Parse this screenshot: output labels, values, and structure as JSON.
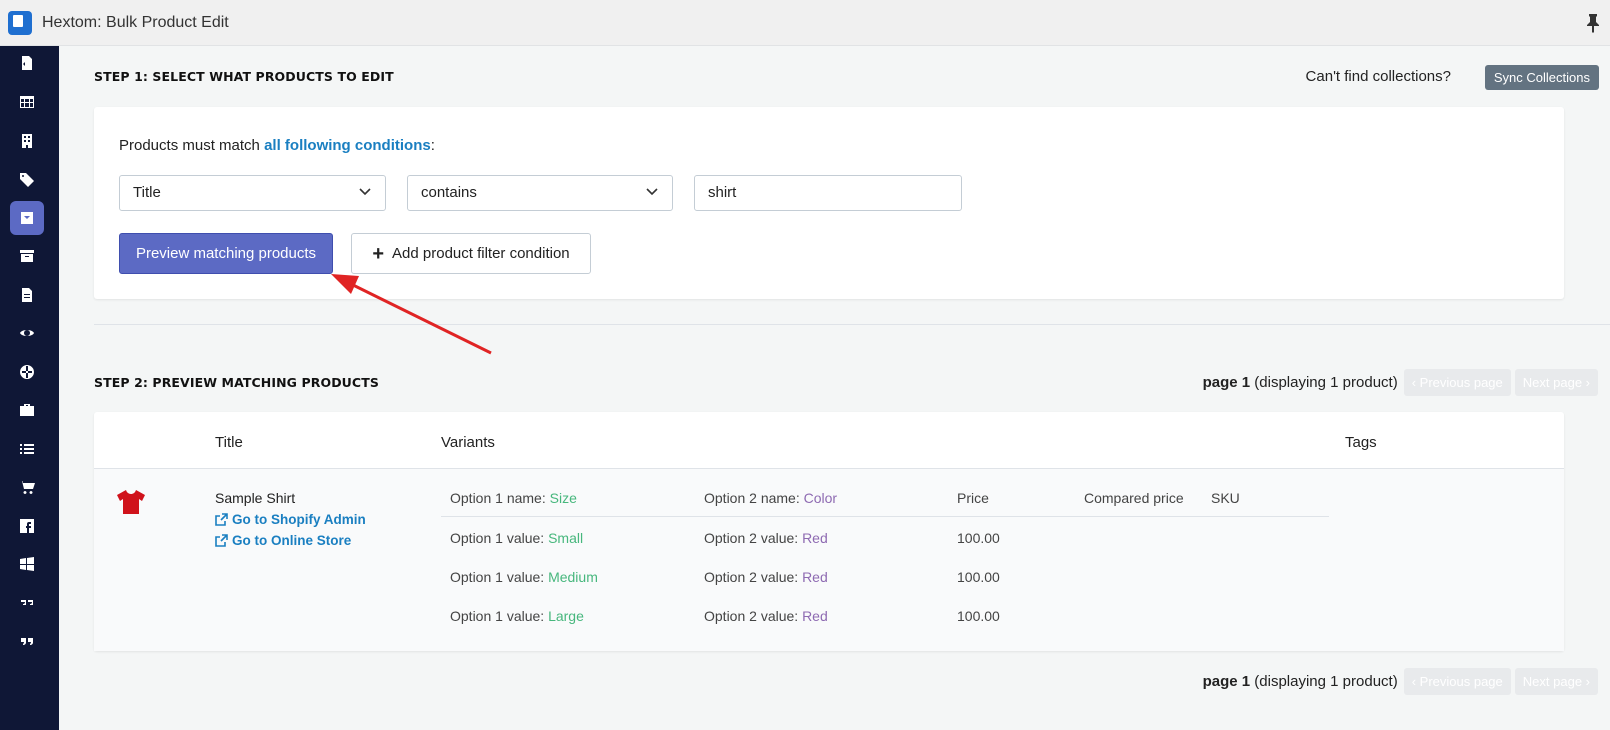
{
  "app": {
    "title": "Hextom: Bulk Product Edit"
  },
  "sidebar": {
    "icons": [
      "file-code-icon",
      "table-icon",
      "building-icon",
      "tag-icon",
      "archive-box-icon",
      "inbox-icon",
      "document-icon",
      "eye-icon",
      "globe-icon",
      "briefcase-icon",
      "list-icon",
      "cart-icon",
      "facebook-icon",
      "windows-icon",
      "quote-left-icon",
      "quote-right-icon"
    ],
    "active_index": 4
  },
  "step1": {
    "title": "STEP 1: SELECT WHAT PRODUCTS TO EDIT",
    "cant_find": "Can't find collections?",
    "sync_label": "Sync Collections",
    "conditions_prefix": "Products must match ",
    "conditions_link": "all following conditions",
    "conditions_suffix": ":",
    "field_value": "Title",
    "operator_value": "contains",
    "filter_value": "shirt",
    "preview_label": "Preview matching products",
    "add_filter_label": "Add product filter condition"
  },
  "step2": {
    "title": "STEP 2: PREVIEW MATCHING PRODUCTS",
    "pager": {
      "page_label": "page 1",
      "count_label": " (displaying 1 product)",
      "prev_label": "Previous page",
      "next_label": "Next page"
    },
    "columns": {
      "title": "Title",
      "variants": "Variants",
      "tags": "Tags"
    },
    "product": {
      "title": "Sample Shirt",
      "admin_link": "Go to Shopify Admin",
      "store_link": "Go to Online Store",
      "image_color": "#d0121b"
    },
    "variant_header": {
      "opt1_label": "Option 1 name: ",
      "opt1_name": "Size",
      "opt2_label": "Option 2 name: ",
      "opt2_name": "Color",
      "price": "Price",
      "compared": "Compared price",
      "sku": "SKU"
    },
    "variants": [
      {
        "opt1_label": "Option 1 value: ",
        "opt1": "Small",
        "opt2_label": "Option 2 value: ",
        "opt2": "Red",
        "price": "100.00"
      },
      {
        "opt1_label": "Option 1 value: ",
        "opt1": "Medium",
        "opt2_label": "Option 2 value: ",
        "opt2": "Red",
        "price": "100.00"
      },
      {
        "opt1_label": "Option 1 value: ",
        "opt1": "Large",
        "opt2_label": "Option 2 value: ",
        "opt2": "Red",
        "price": "100.00"
      }
    ]
  },
  "colors": {
    "accent": "#5c6ac4",
    "sidebar": "#0f1736",
    "link": "#1a7fc1",
    "annotation_arrow": "#e02424"
  }
}
